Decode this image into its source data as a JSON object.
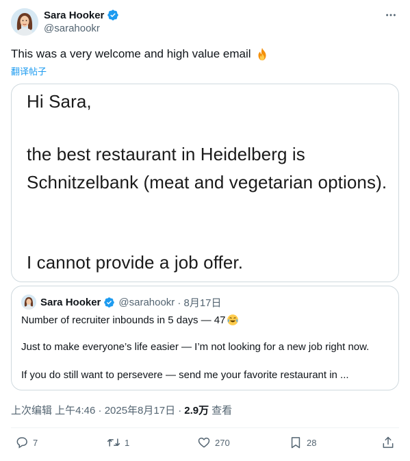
{
  "author": {
    "name": "Sara Hooker",
    "handle": "@sarahookr"
  },
  "tweet": {
    "text": "This was a very welcome and high value email",
    "translate_label": "翻译帖子"
  },
  "email_image": {
    "line1": "Hi Sara,",
    "line2": "the best restaurant in Heidelberg is",
    "line3": "Schnitzelbank (meat and vegetarian options).",
    "line4": "I cannot provide a job offer."
  },
  "quoted_tweet": {
    "name": "Sara Hooker",
    "handle": "@sarahookr",
    "date": "· 8月17日",
    "line1": "Number of recruiter inbounds in 5 days — 47",
    "line2": "Just to make everyone’s life easier — I’m not looking for a new job right now.",
    "line3": "If you do still want to persevere — send me your favorite restaurant in ..."
  },
  "meta": {
    "edited_time": "上次编辑 上午4:46 · 2025年8月17日 ·",
    "views_count": "2.9万",
    "views_label": "查看"
  },
  "actions": {
    "replies": "7",
    "reposts": "1",
    "likes": "270",
    "bookmarks": "28"
  },
  "colors": {
    "accent": "#1d9bf0",
    "secondary_text": "#536471",
    "border": "#cfd9de"
  }
}
